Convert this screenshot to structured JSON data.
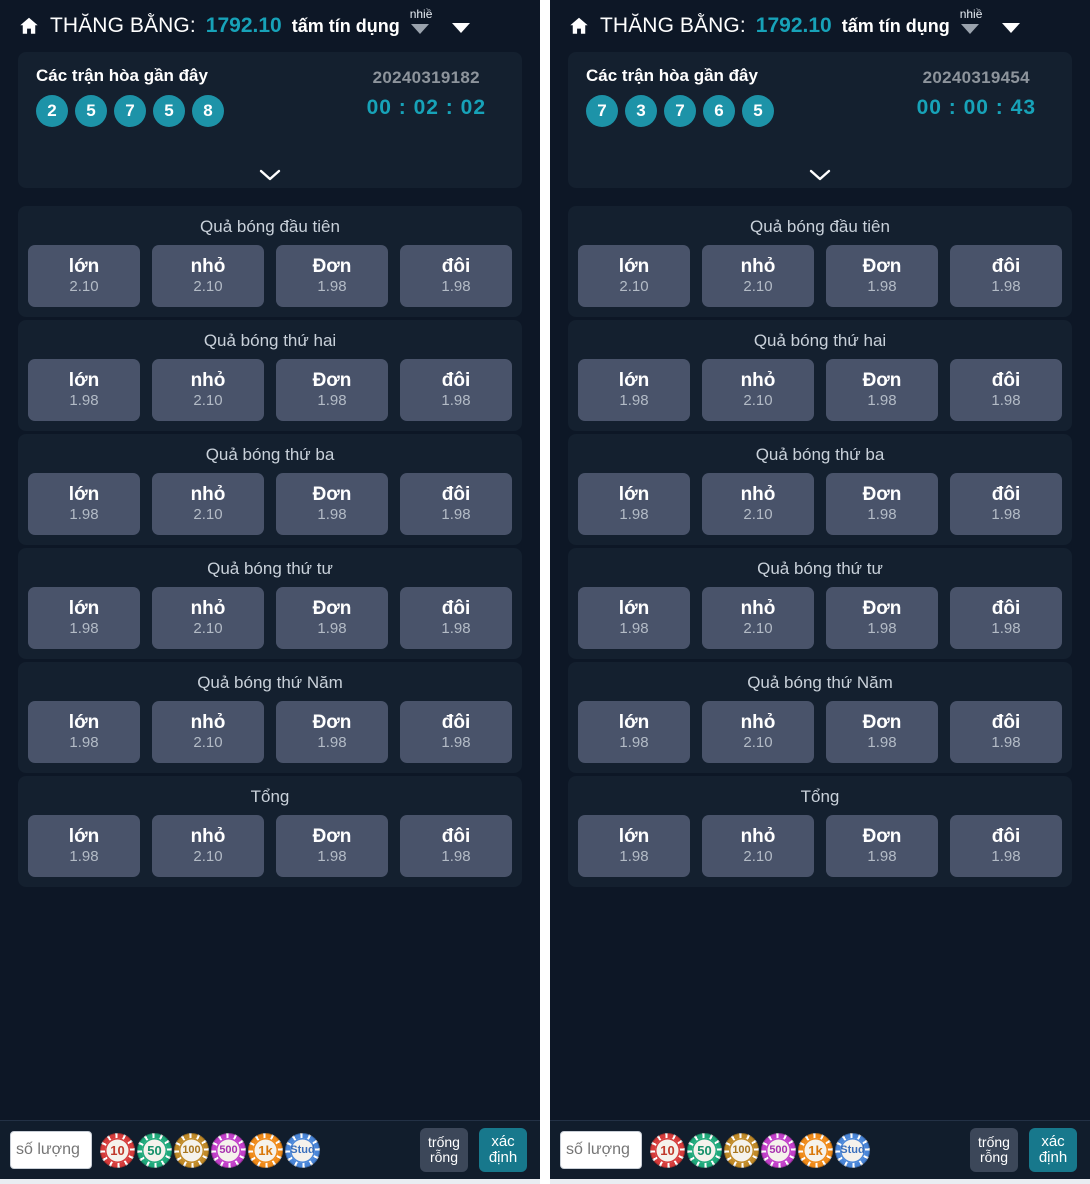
{
  "colors": {
    "page_bg": "#0d1726",
    "card_bg": "#14202f",
    "accent_teal": "#17a2b8",
    "ball_teal": "#1d93a8",
    "bet_btn": "#49536a",
    "confirm": "#17788c",
    "clear": "#3c4759"
  },
  "header": {
    "home_icon": "home-icon",
    "title": "THĂNG BẰNG:",
    "balance": "1792.10",
    "credit_label": "tấm tín dụng",
    "more_label": "nhiề",
    "dropdown_icon": "chevron-down-icon",
    "menu_icon": "chevron-down-icon"
  },
  "result_card": {
    "title": "Các trận hòa gần đây",
    "expand_icon": "chevron-down-icon"
  },
  "bet_section": {
    "groups": [
      {
        "title": "Quả bóng đầu tiên",
        "options": [
          {
            "name": "lớn",
            "odds": "2.10"
          },
          {
            "name": "nhỏ",
            "odds": "2.10"
          },
          {
            "name": "Đơn",
            "odds": "1.98"
          },
          {
            "name": "đôi",
            "odds": "1.98"
          }
        ]
      },
      {
        "title": "Quả bóng thứ hai",
        "options": [
          {
            "name": "lớn",
            "odds": "1.98"
          },
          {
            "name": "nhỏ",
            "odds": "2.10"
          },
          {
            "name": "Đơn",
            "odds": "1.98"
          },
          {
            "name": "đôi",
            "odds": "1.98"
          }
        ]
      },
      {
        "title": "Quả bóng thứ ba",
        "options": [
          {
            "name": "lớn",
            "odds": "1.98"
          },
          {
            "name": "nhỏ",
            "odds": "2.10"
          },
          {
            "name": "Đơn",
            "odds": "1.98"
          },
          {
            "name": "đôi",
            "odds": "1.98"
          }
        ]
      },
      {
        "title": "Quả bóng thứ tư",
        "options": [
          {
            "name": "lớn",
            "odds": "1.98"
          },
          {
            "name": "nhỏ",
            "odds": "2.10"
          },
          {
            "name": "Đơn",
            "odds": "1.98"
          },
          {
            "name": "đôi",
            "odds": "1.98"
          }
        ]
      },
      {
        "title": "Quả bóng thứ Năm",
        "options": [
          {
            "name": "lớn",
            "odds": "1.98"
          },
          {
            "name": "nhỏ",
            "odds": "2.10"
          },
          {
            "name": "Đơn",
            "odds": "1.98"
          },
          {
            "name": "đôi",
            "odds": "1.98"
          }
        ]
      },
      {
        "title": "Tổng",
        "options": [
          {
            "name": "lớn",
            "odds": "1.98"
          },
          {
            "name": "nhỏ",
            "odds": "2.10"
          },
          {
            "name": "Đơn",
            "odds": "1.98"
          },
          {
            "name": "đôi",
            "odds": "1.98"
          }
        ]
      }
    ]
  },
  "bottom_bar": {
    "amount_placeholder": "số lượng",
    "amount_value": "",
    "chips": [
      {
        "label": "10",
        "ring": "#d53b3b",
        "text": "#c0392b"
      },
      {
        "label": "50",
        "ring": "#1fa97b",
        "text": "#15906a"
      },
      {
        "label": "100",
        "ring": "#c08a28",
        "text": "#a9751d"
      },
      {
        "label": "500",
        "ring": "#c13fc9",
        "text": "#a832b0"
      },
      {
        "label": "1k",
        "ring": "#ef8a19",
        "text": "#d97709"
      },
      {
        "label": "Stud",
        "ring": "#4a86d8",
        "text": "#3a6fbd"
      }
    ],
    "clear_label_line1": "trống",
    "clear_label_line2": "rỗng",
    "confirm_label_line1": "xác",
    "confirm_label_line2": "định"
  },
  "panels": [
    {
      "id": "left",
      "period": "20240319182",
      "countdown": "00 : 02 : 02",
      "recent_balls": [
        "2",
        "5",
        "7",
        "5",
        "8"
      ]
    },
    {
      "id": "right",
      "period": "20240319454",
      "countdown": "00 : 00 : 43",
      "recent_balls": [
        "7",
        "3",
        "7",
        "6",
        "5"
      ]
    }
  ]
}
